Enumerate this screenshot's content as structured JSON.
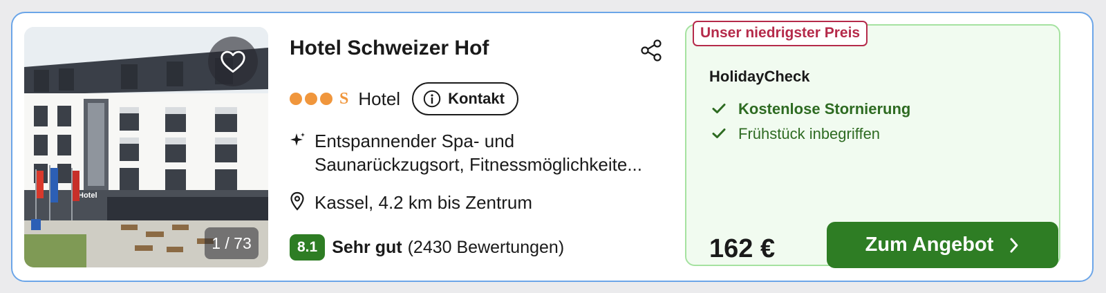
{
  "card": {
    "highlight_color": "#6ba5e8"
  },
  "photo": {
    "counter": "1 / 73",
    "favorite_icon": "heart-icon",
    "building_sign": "Hotel"
  },
  "hotel": {
    "name": "Hotel Schweizer Hof",
    "share_icon": "share-icon",
    "rating_dots": 3,
    "rating_mark": "S",
    "type": "Hotel",
    "contact_label": "Kontakt",
    "feature_line1": "Entspannender Spa- und",
    "feature_line2": "Saunarückzugsort, Fitnessmöglichkeite...",
    "location": "Kassel, 4.2 km bis Zentrum",
    "score": "8.1",
    "verdict": "Sehr gut",
    "reviews": "(2430 Bewertungen)"
  },
  "offer": {
    "badge": "Unser niedrigster Preis",
    "provider": "HolidayCheck",
    "perks": [
      "Kostenlose Stornierung",
      "Frühstück inbegriffen"
    ],
    "price": "162 €",
    "cta_label": "Zum Angebot"
  },
  "colors": {
    "accent_green": "#2e7d24",
    "badge_red": "#b52a4a",
    "rating_orange": "#f0963c",
    "offer_background": "#f1fbf0"
  }
}
